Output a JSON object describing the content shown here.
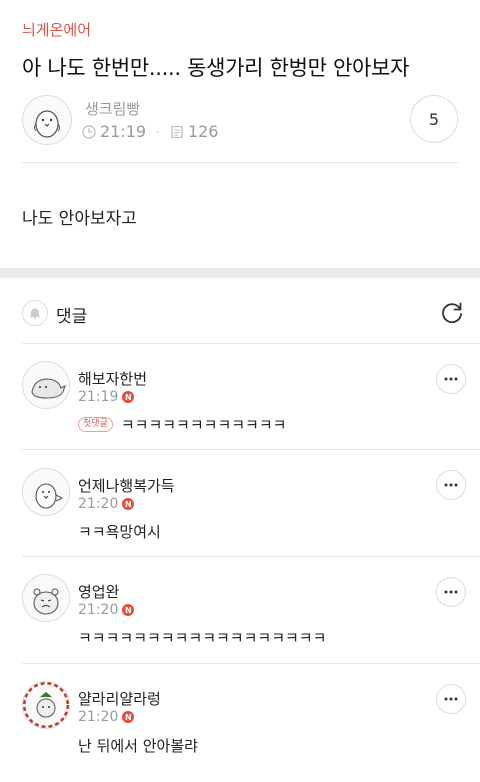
{
  "board": "늬게온에어",
  "post": {
    "title": "아 나도 한번만..... 동생가리 한벙만 안아보자",
    "author": "생크림빵",
    "time": "21:19",
    "views": "126",
    "comment_count": "5",
    "body": "나도 안아보자고"
  },
  "comments_section": {
    "label": "댓글"
  },
  "comments": [
    {
      "name": "해보자한번",
      "time": "21:19",
      "new_badge": "N",
      "first_badge": "첫댓글",
      "text": "ㅋㅋㅋㅋㅋㅋㅋㅋㅋㅋㅋㅋ"
    },
    {
      "name": "언제나행복가득",
      "time": "21:20",
      "new_badge": "N",
      "text": "ㅋㅋ욕망여시"
    },
    {
      "name": "영업완",
      "time": "21:20",
      "new_badge": "N",
      "text": "ㅋㅋㅋㅋㅋㅋㅋㅋㅋㅋㅋㅋㅋㅋㅋㅋㅋㅋ"
    },
    {
      "name": "얄라리얄라렁",
      "time": "21:20",
      "new_badge": "N",
      "text": "난 뒤에서 안아볼랴"
    }
  ],
  "colors": {
    "accent": "#d9534f",
    "badge": "#e74c3c",
    "muted": "#999999"
  }
}
